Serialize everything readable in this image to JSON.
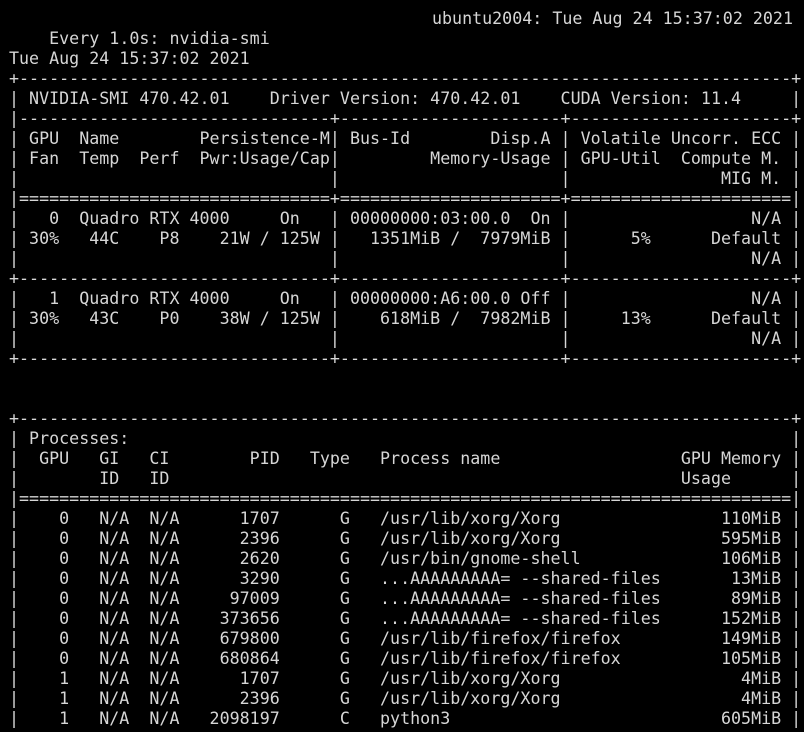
{
  "watch_header": {
    "command": "Every 1.0s: nvidia-smi",
    "host_time": "ubuntu2004: Tue Aug 24 15:37:02 2021"
  },
  "output_lines": [
    "",
    "Tue Aug 24 15:37:02 2021",
    "+-----------------------------------------------------------------------------+",
    "| NVIDIA-SMI 470.42.01    Driver Version: 470.42.01    CUDA Version: 11.4     |",
    "|-------------------------------+----------------------+----------------------+",
    "| GPU  Name        Persistence-M| Bus-Id        Disp.A | Volatile Uncorr. ECC |",
    "| Fan  Temp  Perf  Pwr:Usage/Cap|         Memory-Usage | GPU-Util  Compute M. |",
    "|                               |                      |               MIG M. |",
    "|===============================+======================+======================|",
    "|   0  Quadro RTX 4000     On   | 00000000:03:00.0  On |                  N/A |",
    "| 30%   44C    P8    21W / 125W |   1351MiB /  7979MiB |      5%      Default |",
    "|                               |                      |                  N/A |",
    "+-------------------------------+----------------------+----------------------+",
    "|   1  Quadro RTX 4000     On   | 00000000:A6:00.0 Off |                  N/A |",
    "| 30%   43C    P0    38W / 125W |    618MiB /  7982MiB |     13%      Default |",
    "|                               |                      |                  N/A |",
    "+-------------------------------+----------------------+----------------------+",
    "",
    "",
    "+-----------------------------------------------------------------------------+",
    "| Processes:                                                                  |",
    "|  GPU   GI   CI        PID   Type   Process name                  GPU Memory |",
    "|        ID   ID                                                   Usage      |",
    "|=============================================================================|",
    "|    0   N/A  N/A      1707      G   /usr/lib/xorg/Xorg                110MiB |",
    "|    0   N/A  N/A      2396      G   /usr/lib/xorg/Xorg                595MiB |",
    "|    0   N/A  N/A      2620      G   /usr/bin/gnome-shell              106MiB |",
    "|    0   N/A  N/A      3290      G   ...AAAAAAAAA= --shared-files       13MiB |",
    "|    0   N/A  N/A     97009      G   ...AAAAAAAAA= --shared-files       89MiB |",
    "|    0   N/A  N/A    373656      G   ...AAAAAAAAA= --shared-files      152MiB |",
    "|    0   N/A  N/A    679800      G   /usr/lib/firefox/firefox          149MiB |",
    "|    0   N/A  N/A    680864      G   /usr/lib/firefox/firefox          105MiB |",
    "|    1   N/A  N/A      1707      G   /usr/lib/xorg/Xorg                  4MiB |",
    "|    1   N/A  N/A      2396      G   /usr/lib/xorg/Xorg                  4MiB |",
    "|    1   N/A  N/A   2098197      C   python3                           605MiB |",
    "+-----------------------------------------------------------------------------+"
  ],
  "colors": {
    "background": "#000000",
    "foreground": "#d6d6d6"
  }
}
